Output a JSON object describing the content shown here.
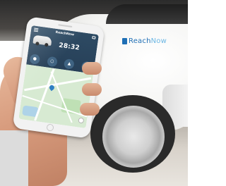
{
  "car": {
    "logo_reach": "Reach",
    "logo_now": "Now",
    "brand_color": "#1f6fb5",
    "accent_color": "#6bb7e4"
  },
  "app": {
    "title": "ReachNow",
    "timer": "28:32",
    "header_color": "#2d4a63",
    "map_color": "#d7ead2",
    "icons": [
      "menu-icon",
      "chat-icon",
      "car-icon",
      "lock-icon",
      "unlock-icon",
      "horn-icon",
      "lights-icon",
      "locate-icon",
      "map-pin-icon"
    ]
  }
}
